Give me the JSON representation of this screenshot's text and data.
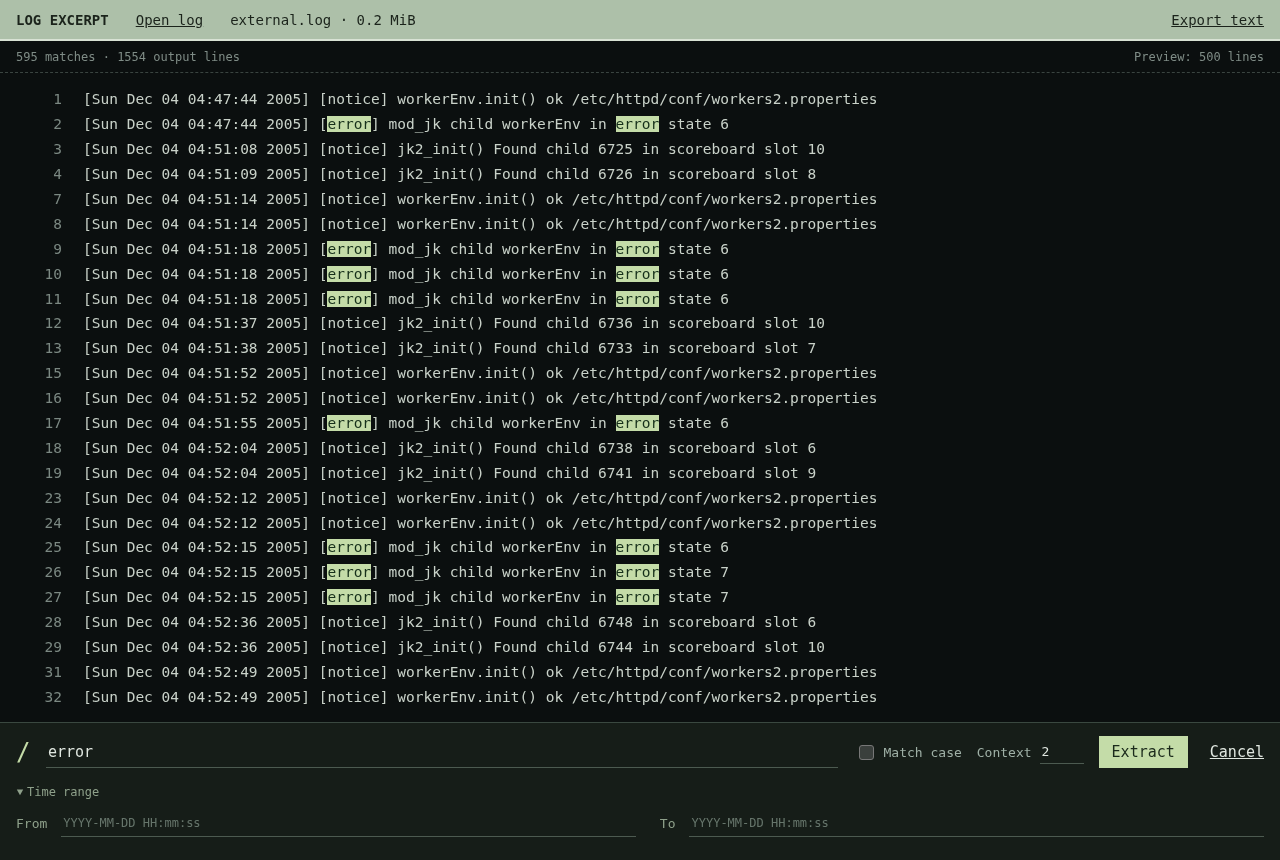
{
  "header": {
    "title": "LOG EXCERPT",
    "open_link": "Open log",
    "file_info": "external.log · 0.2 MiB",
    "export_link": "Export text"
  },
  "summary": {
    "matches": "595 matches · 1554 output lines",
    "preview": "Preview: 500 lines"
  },
  "lines": [
    {
      "number": "1",
      "parts": [
        {
          "text": "[Sun Dec 04 04:47:44 2005] [notice] workerEnv.init() ok /etc/httpd/conf/workers2.properties",
          "match": false
        }
      ]
    },
    {
      "number": "2",
      "parts": [
        {
          "text": "[Sun Dec 04 04:47:44 2005] [",
          "match": false
        },
        {
          "text": "error",
          "match": true
        },
        {
          "text": "] mod_jk child workerEnv in ",
          "match": false
        },
        {
          "text": "error",
          "match": true
        },
        {
          "text": " state 6",
          "match": false
        }
      ]
    },
    {
      "number": "3",
      "parts": [
        {
          "text": "[Sun Dec 04 04:51:08 2005] [notice] jk2_init() Found child 6725 in scoreboard slot 10",
          "match": false
        }
      ]
    },
    {
      "number": "4",
      "parts": [
        {
          "text": "[Sun Dec 04 04:51:09 2005] [notice] jk2_init() Found child 6726 in scoreboard slot 8",
          "match": false
        }
      ]
    },
    {
      "number": "7",
      "parts": [
        {
          "text": "[Sun Dec 04 04:51:14 2005] [notice] workerEnv.init() ok /etc/httpd/conf/workers2.properties",
          "match": false
        }
      ]
    },
    {
      "number": "8",
      "parts": [
        {
          "text": "[Sun Dec 04 04:51:14 2005] [notice] workerEnv.init() ok /etc/httpd/conf/workers2.properties",
          "match": false
        }
      ]
    },
    {
      "number": "9",
      "parts": [
        {
          "text": "[Sun Dec 04 04:51:18 2005] [",
          "match": false
        },
        {
          "text": "error",
          "match": true
        },
        {
          "text": "] mod_jk child workerEnv in ",
          "match": false
        },
        {
          "text": "error",
          "match": true
        },
        {
          "text": " state 6",
          "match": false
        }
      ]
    },
    {
      "number": "10",
      "parts": [
        {
          "text": "[Sun Dec 04 04:51:18 2005] [",
          "match": false
        },
        {
          "text": "error",
          "match": true
        },
        {
          "text": "] mod_jk child workerEnv in ",
          "match": false
        },
        {
          "text": "error",
          "match": true
        },
        {
          "text": " state 6",
          "match": false
        }
      ]
    },
    {
      "number": "11",
      "parts": [
        {
          "text": "[Sun Dec 04 04:51:18 2005] [",
          "match": false
        },
        {
          "text": "error",
          "match": true
        },
        {
          "text": "] mod_jk child workerEnv in ",
          "match": false
        },
        {
          "text": "error",
          "match": true
        },
        {
          "text": " state 6",
          "match": false
        }
      ]
    },
    {
      "number": "12",
      "parts": [
        {
          "text": "[Sun Dec 04 04:51:37 2005] [notice] jk2_init() Found child 6736 in scoreboard slot 10",
          "match": false
        }
      ]
    },
    {
      "number": "13",
      "parts": [
        {
          "text": "[Sun Dec 04 04:51:38 2005] [notice] jk2_init() Found child 6733 in scoreboard slot 7",
          "match": false
        }
      ]
    },
    {
      "number": "15",
      "parts": [
        {
          "text": "[Sun Dec 04 04:51:52 2005] [notice] workerEnv.init() ok /etc/httpd/conf/workers2.properties",
          "match": false
        }
      ]
    },
    {
      "number": "16",
      "parts": [
        {
          "text": "[Sun Dec 04 04:51:52 2005] [notice] workerEnv.init() ok /etc/httpd/conf/workers2.properties",
          "match": false
        }
      ]
    },
    {
      "number": "17",
      "parts": [
        {
          "text": "[Sun Dec 04 04:51:55 2005] [",
          "match": false
        },
        {
          "text": "error",
          "match": true
        },
        {
          "text": "] mod_jk child workerEnv in ",
          "match": false
        },
        {
          "text": "error",
          "match": true
        },
        {
          "text": " state 6",
          "match": false
        }
      ]
    },
    {
      "number": "18",
      "parts": [
        {
          "text": "[Sun Dec 04 04:52:04 2005] [notice] jk2_init() Found child 6738 in scoreboard slot 6",
          "match": false
        }
      ]
    },
    {
      "number": "19",
      "parts": [
        {
          "text": "[Sun Dec 04 04:52:04 2005] [notice] jk2_init() Found child 6741 in scoreboard slot 9",
          "match": false
        }
      ]
    },
    {
      "number": "23",
      "parts": [
        {
          "text": "[Sun Dec 04 04:52:12 2005] [notice] workerEnv.init() ok /etc/httpd/conf/workers2.properties",
          "match": false
        }
      ]
    },
    {
      "number": "24",
      "parts": [
        {
          "text": "[Sun Dec 04 04:52:12 2005] [notice] workerEnv.init() ok /etc/httpd/conf/workers2.properties",
          "match": false
        }
      ]
    },
    {
      "number": "25",
      "parts": [
        {
          "text": "[Sun Dec 04 04:52:15 2005] [",
          "match": false
        },
        {
          "text": "error",
          "match": true
        },
        {
          "text": "] mod_jk child workerEnv in ",
          "match": false
        },
        {
          "text": "error",
          "match": true
        },
        {
          "text": " state 6",
          "match": false
        }
      ]
    },
    {
      "number": "26",
      "parts": [
        {
          "text": "[Sun Dec 04 04:52:15 2005] [",
          "match": false
        },
        {
          "text": "error",
          "match": true
        },
        {
          "text": "] mod_jk child workerEnv in ",
          "match": false
        },
        {
          "text": "error",
          "match": true
        },
        {
          "text": " state 7",
          "match": false
        }
      ]
    },
    {
      "number": "27",
      "parts": [
        {
          "text": "[Sun Dec 04 04:52:15 2005] [",
          "match": false
        },
        {
          "text": "error",
          "match": true
        },
        {
          "text": "] mod_jk child workerEnv in ",
          "match": false
        },
        {
          "text": "error",
          "match": true
        },
        {
          "text": " state 7",
          "match": false
        }
      ]
    },
    {
      "number": "28",
      "parts": [
        {
          "text": "[Sun Dec 04 04:52:36 2005] [notice] jk2_init() Found child 6748 in scoreboard slot 6",
          "match": false
        }
      ]
    },
    {
      "number": "29",
      "parts": [
        {
          "text": "[Sun Dec 04 04:52:36 2005] [notice] jk2_init() Found child 6744 in scoreboard slot 10",
          "match": false
        }
      ]
    },
    {
      "number": "31",
      "parts": [
        {
          "text": "[Sun Dec 04 04:52:49 2005] [notice] workerEnv.init() ok /etc/httpd/conf/workers2.properties",
          "match": false
        }
      ]
    },
    {
      "number": "32",
      "parts": [
        {
          "text": "[Sun Dec 04 04:52:49 2005] [notice] workerEnv.init() ok /etc/httpd/conf/workers2.properties",
          "match": false
        }
      ]
    }
  ],
  "search": {
    "prompt": "/",
    "query": "error",
    "match_case": {
      "label": "Match case",
      "checked": false
    },
    "context": {
      "label": "Context",
      "value": "2"
    },
    "extract": "Extract",
    "cancel": "Cancel"
  },
  "time_range": {
    "label": "Time range",
    "expanded": true,
    "from": {
      "label": "From",
      "placeholder": "YYYY-MM-DD HH:mm:ss"
    },
    "to": {
      "label": "To",
      "placeholder": "YYYY-MM-DD HH:mm:ss"
    }
  }
}
